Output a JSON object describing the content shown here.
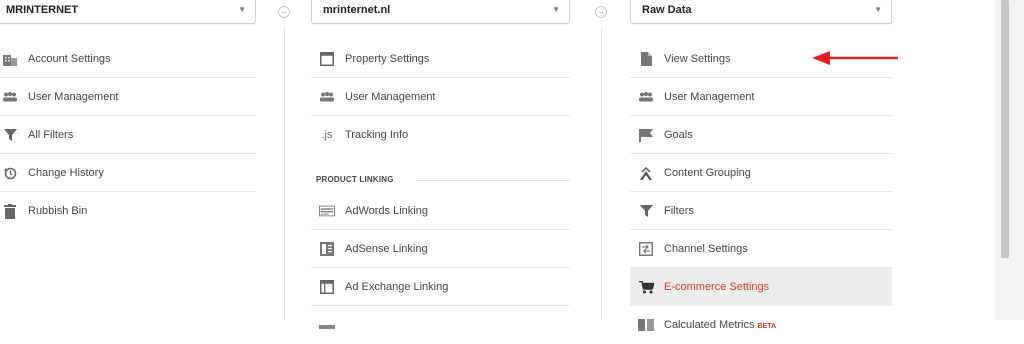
{
  "account": {
    "selector_label": "MRINTERNET",
    "items": [
      {
        "label": "Account Settings",
        "icon": "building-icon"
      },
      {
        "label": "User Management",
        "icon": "users-icon"
      },
      {
        "label": "All Filters",
        "icon": "filter-icon"
      },
      {
        "label": "Change History",
        "icon": "history-icon"
      },
      {
        "label": "Rubbish Bin",
        "icon": "trash-icon"
      }
    ]
  },
  "property": {
    "selector_label": "mrinternet.nl",
    "items": [
      {
        "label": "Property Settings",
        "icon": "window-icon"
      },
      {
        "label": "User Management",
        "icon": "users-icon"
      },
      {
        "label": "Tracking Info",
        "icon": "js-icon",
        "icon_text": ".js"
      }
    ],
    "section_heading": "PRODUCT LINKING",
    "linking_items": [
      {
        "label": "AdWords Linking",
        "icon": "adwords-icon"
      },
      {
        "label": "AdSense Linking",
        "icon": "adsense-icon"
      },
      {
        "label": "Ad Exchange Linking",
        "icon": "adexchange-icon"
      }
    ]
  },
  "view": {
    "selector_label": "Raw Data",
    "items": [
      {
        "label": "View Settings",
        "icon": "document-icon"
      },
      {
        "label": "User Management",
        "icon": "users-icon"
      },
      {
        "label": "Goals",
        "icon": "flag-icon"
      },
      {
        "label": "Content Grouping",
        "icon": "content-grouping-icon"
      },
      {
        "label": "Filters",
        "icon": "filter-icon"
      },
      {
        "label": "Channel Settings",
        "icon": "channel-icon"
      },
      {
        "label": "E-commerce Settings",
        "icon": "cart-icon",
        "active": true
      },
      {
        "label": "Calculated Metrics",
        "icon": "calculated-icon",
        "badge": "BETA"
      }
    ]
  },
  "colors": {
    "active_text": "#d93a2b",
    "active_bg": "#ececec",
    "arrow": "#e02020"
  }
}
